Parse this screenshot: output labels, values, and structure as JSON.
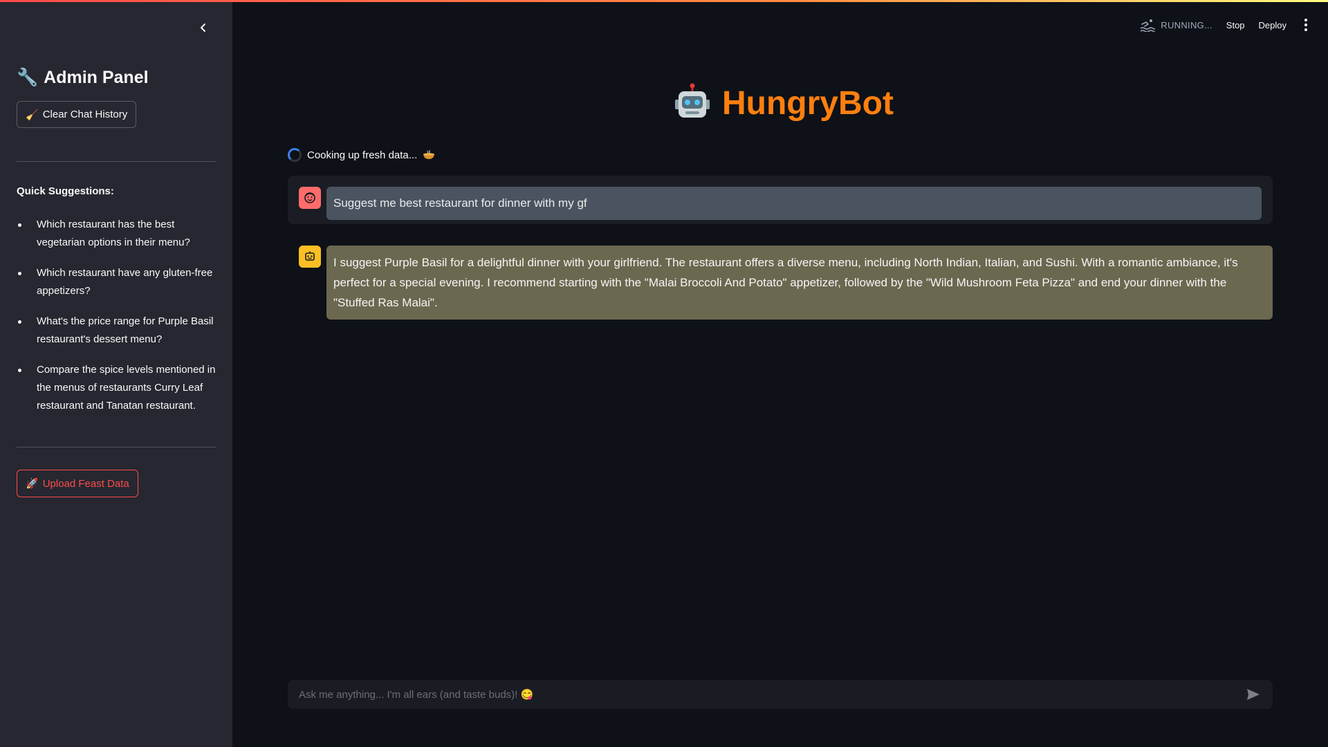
{
  "sidebar": {
    "title": "Admin Panel",
    "clear_button": "Clear Chat History",
    "quick_suggestions_title": "Quick Suggestions:",
    "suggestions": [
      "Which restaurant has the best vegetarian options in their menu?",
      "Which restaurant have any gluten-free appetizers?",
      "What's the price range for Purple Basil restaurant's dessert menu?",
      "Compare the spice levels mentioned in the menus of restaurants Curry Leaf restaurant and Tanatan restaurant."
    ],
    "upload_button": "Upload Feast Data"
  },
  "toolbar": {
    "status": "RUNNING...",
    "stop": "Stop",
    "deploy": "Deploy"
  },
  "main": {
    "title": "HungryBot",
    "status_text": "Cooking up fresh data...",
    "messages": [
      {
        "role": "user",
        "text": "Suggest me best restaurant for dinner with my gf"
      },
      {
        "role": "assistant",
        "text": "I suggest Purple Basil for a delightful dinner with your girlfriend. The restaurant offers a diverse menu, including North Indian, Italian, and Sushi. With a romantic ambiance, it's perfect for a special evening. I recommend starting with the \"Malai Broccoli And Potato\" appetizer, followed by the \"Wild Mushroom Feta Pizza\" and end your dinner with the \"Stuffed Ras Malai\"."
      }
    ],
    "input_placeholder": "Ask me anything... I'm all ears (and taste buds)! 😋"
  },
  "colors": {
    "accent": "#ff4b4b",
    "title": "#ff7f0e",
    "user_avatar": "#ff6b6b",
    "bot_avatar": "#fbbf24"
  },
  "icons": {
    "collapse": "chevron-left-icon",
    "admin": "wrench-icon",
    "clear": "broom-icon",
    "upload": "rocket-icon",
    "title": "robot-icon",
    "status": "bowl-icon",
    "running": "swimmer-icon",
    "menu": "more-vertical-icon",
    "send": "send-icon"
  }
}
